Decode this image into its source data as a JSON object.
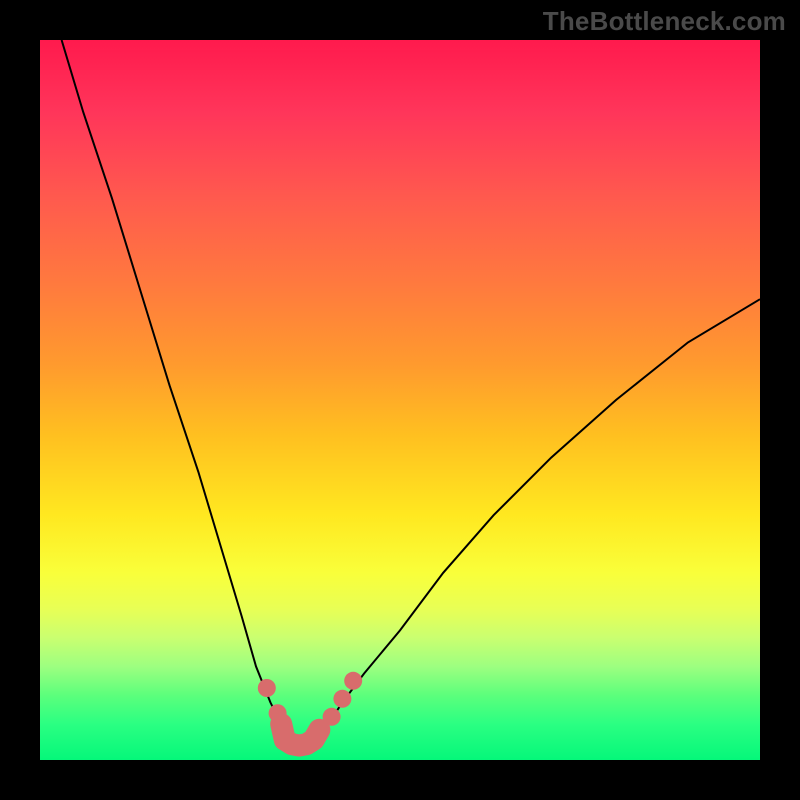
{
  "watermark": "TheBottleneck.com",
  "colors": {
    "frame": "#000000",
    "gradient_top": "#ff1a4d",
    "gradient_mid": "#ffe820",
    "gradient_bottom": "#05f77a",
    "curve": "#000000",
    "marker": "#d86c6c"
  },
  "chart_data": {
    "type": "line",
    "title": "",
    "xlabel": "",
    "ylabel": "",
    "xlim": [
      0,
      100
    ],
    "ylim": [
      0,
      100
    ],
    "series": [
      {
        "name": "bottleneck-curve",
        "x": [
          3,
          6,
          10,
          14,
          18,
          22,
          25,
          28,
          30,
          32,
          33.5,
          35,
          36,
          37,
          38,
          40,
          42,
          45,
          50,
          56,
          63,
          71,
          80,
          90,
          100
        ],
        "y": [
          100,
          90,
          78,
          65,
          52,
          40,
          30,
          20,
          13,
          8,
          5,
          3,
          2,
          2,
          3,
          5,
          8,
          12,
          18,
          26,
          34,
          42,
          50,
          58,
          64
        ]
      }
    ],
    "highlight_points": {
      "name": "salmon-dots",
      "x": [
        31.5,
        33.0,
        40.5,
        42.0,
        43.5
      ],
      "y": [
        10.0,
        6.5,
        6.0,
        8.5,
        11.0
      ]
    },
    "bottom_marker": {
      "name": "salmon-L",
      "x": [
        33.5,
        34.0,
        35.0,
        36.0,
        37.0,
        38.0,
        38.8
      ],
      "y": [
        5.0,
        2.8,
        2.2,
        2.0,
        2.2,
        2.8,
        4.2
      ]
    }
  }
}
